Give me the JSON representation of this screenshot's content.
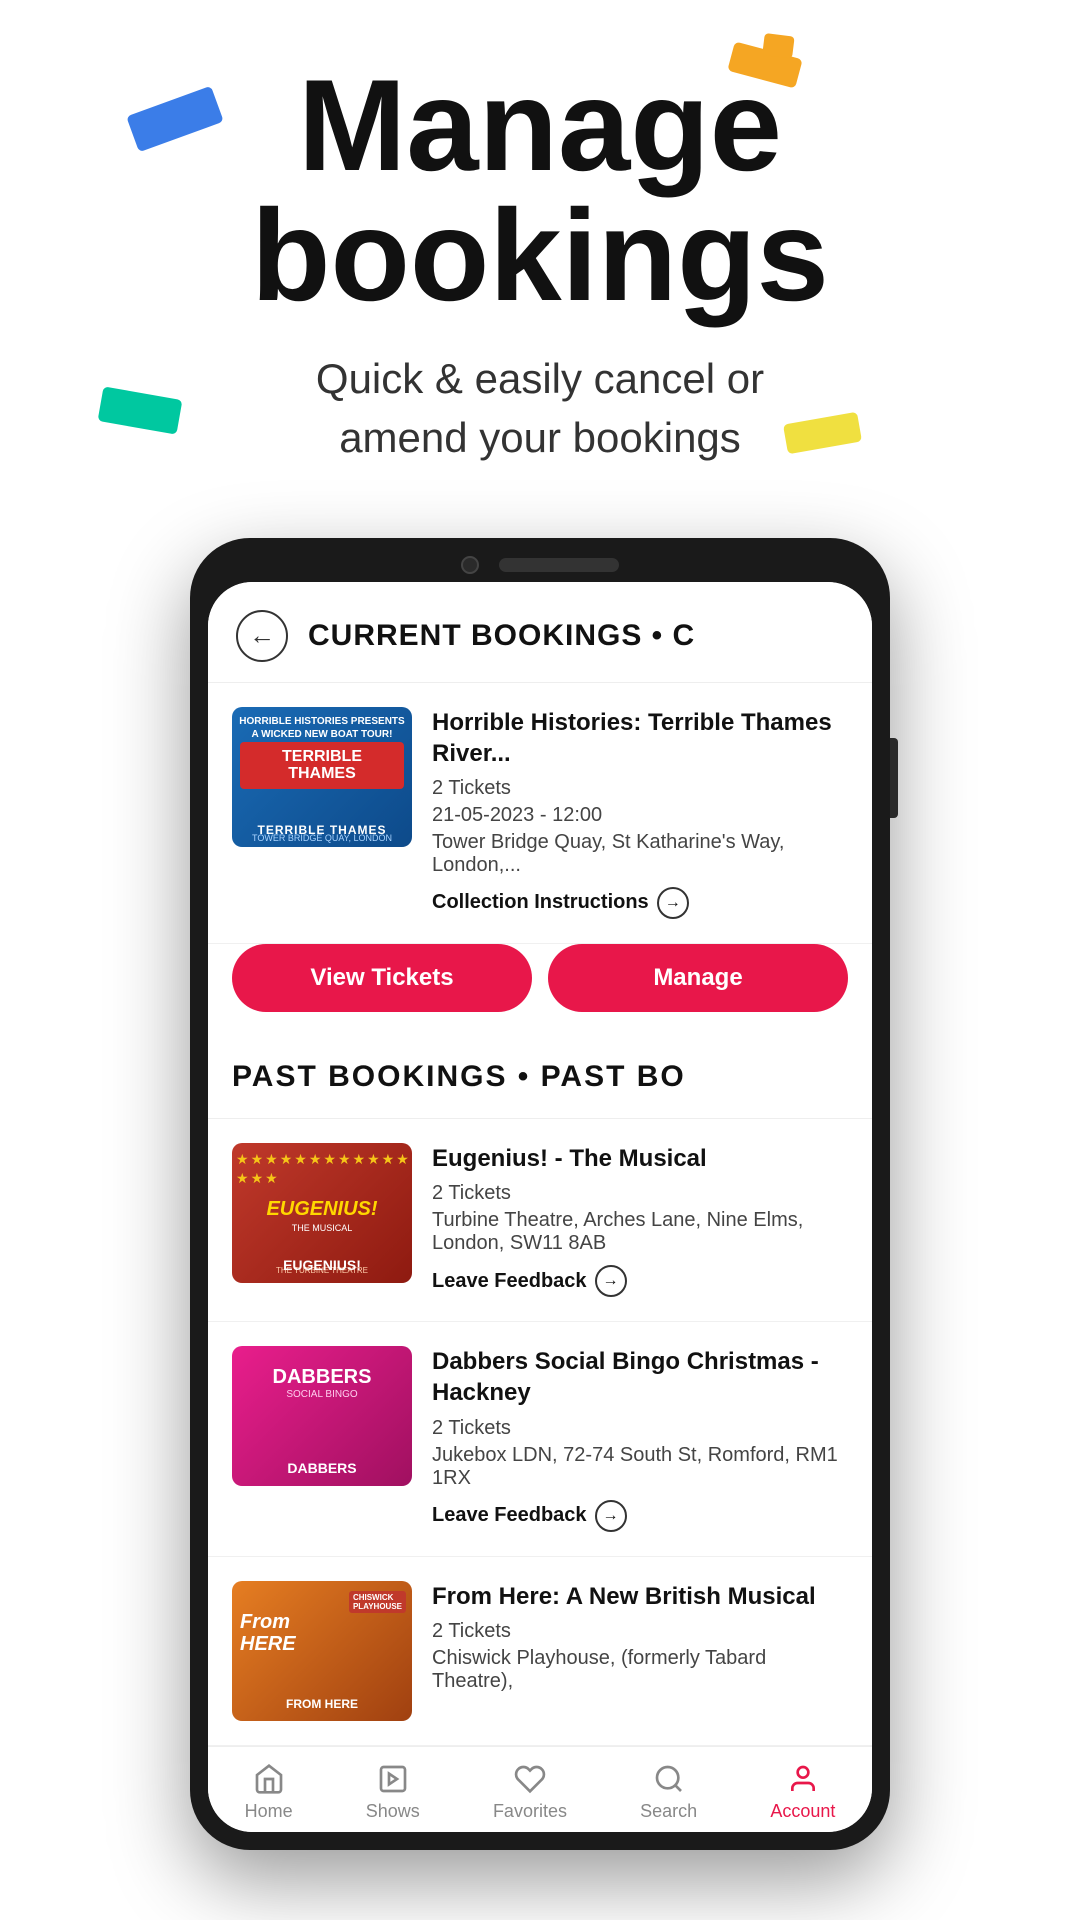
{
  "hero": {
    "title_line1": "Manage",
    "title_line2": "bookings",
    "subtitle": "Quick & easily cancel or\namend your bookings"
  },
  "phone": {
    "header": {
      "title": "CURRENT BOOKINGS • C"
    },
    "current_bookings": [
      {
        "id": "horrible-histories",
        "title": "Horrible Histories: Terrible Thames River...",
        "tickets": "2 Tickets",
        "date": "21-05-2023 - 12:00",
        "venue": "Tower Bridge Quay, St Katharine's Way, London,...",
        "collection_label": "Collection Instructions",
        "btn_view": "View Tickets",
        "btn_manage": "Manage"
      }
    ],
    "past_header": "PAST BOOKINGS • PAST BO",
    "past_bookings": [
      {
        "id": "eugenius",
        "title": "Eugenius! - The Musical",
        "tickets": "2 Tickets",
        "venue": "Turbine Theatre, Arches Lane, Nine Elms, London, SW11 8AB",
        "feedback_label": "Leave Feedback"
      },
      {
        "id": "dabbers",
        "title": "Dabbers Social Bingo Christmas - Hackney",
        "tickets": "2 Tickets",
        "venue": "Jukebox LDN, 72-74 South St, Romford, RM1 1RX",
        "feedback_label": "Leave Feedback"
      },
      {
        "id": "fromhere",
        "title": "From Here: A New British Musical",
        "tickets": "2 Tickets",
        "venue": "Chiswick Playhouse, (formerly Tabard Theatre),"
      }
    ]
  },
  "nav": {
    "items": [
      {
        "id": "home",
        "label": "Home",
        "icon": "🏠",
        "active": false
      },
      {
        "id": "shows",
        "label": "Shows",
        "icon": "⭐",
        "active": false
      },
      {
        "id": "favorites",
        "label": "Favorites",
        "icon": "♡",
        "active": false
      },
      {
        "id": "search",
        "label": "Search",
        "icon": "🔍",
        "active": false
      },
      {
        "id": "account",
        "label": "Account",
        "icon": "👤",
        "active": true
      }
    ]
  }
}
